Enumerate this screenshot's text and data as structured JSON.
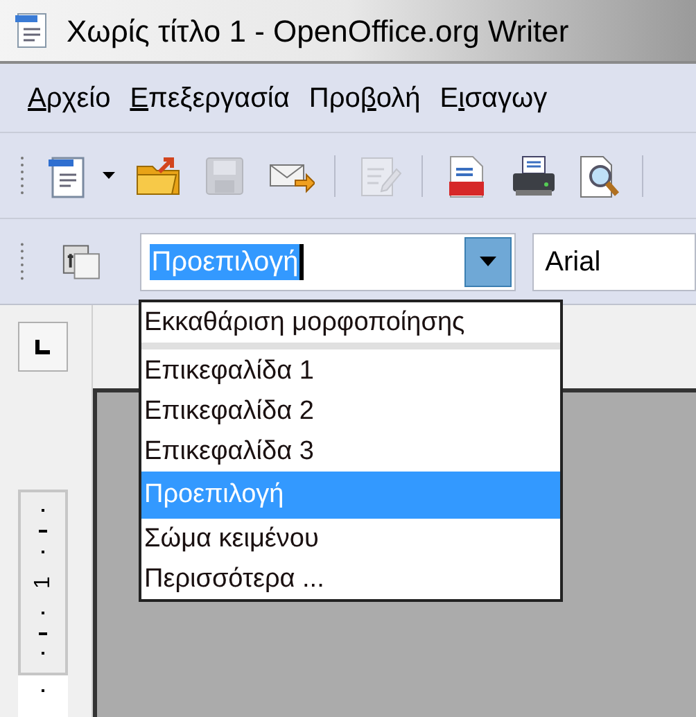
{
  "window": {
    "title": "Χωρίς τίτλο 1 - OpenOffice.org Writer"
  },
  "menu": [
    {
      "key": "Α",
      "after": "ρχείο"
    },
    {
      "key": "Ε",
      "after": "πεξεργασία"
    },
    {
      "before": "Προ",
      "key": "β",
      "after": "ολή"
    },
    {
      "before": "Ε",
      "key": "ι",
      "after": "σαγωγ"
    }
  ],
  "toolbar": [
    {
      "kind": "new",
      "disabled": false
    },
    {
      "kind": "open",
      "disabled": false
    },
    {
      "kind": "save",
      "disabled": true
    },
    {
      "kind": "email",
      "disabled": false
    },
    {
      "kind": "separator"
    },
    {
      "kind": "edit",
      "disabled": true
    },
    {
      "kind": "separator"
    },
    {
      "kind": "pdf",
      "disabled": false
    },
    {
      "kind": "print",
      "disabled": false
    },
    {
      "kind": "preview",
      "disabled": false
    },
    {
      "kind": "separator"
    }
  ],
  "style_box": {
    "value": "Προεπιλογή",
    "expanded": true
  },
  "font_box": {
    "value": "Arial"
  },
  "style_list": [
    {
      "label": "Εκκαθάριση μορφοποίησης",
      "selected": false
    },
    {
      "label": "Επικεφαλίδα 1",
      "selected": false
    },
    {
      "label": "Επικεφαλίδα 2",
      "selected": false
    },
    {
      "label": "Επικεφαλίδα 3",
      "selected": false
    },
    {
      "label": "Προεπιλογή",
      "selected": true
    },
    {
      "label": "Σώμα κειμένου",
      "selected": false
    },
    {
      "label": "Περισσότερα ...",
      "selected": false
    }
  ],
  "ruler": {
    "label": "1"
  }
}
